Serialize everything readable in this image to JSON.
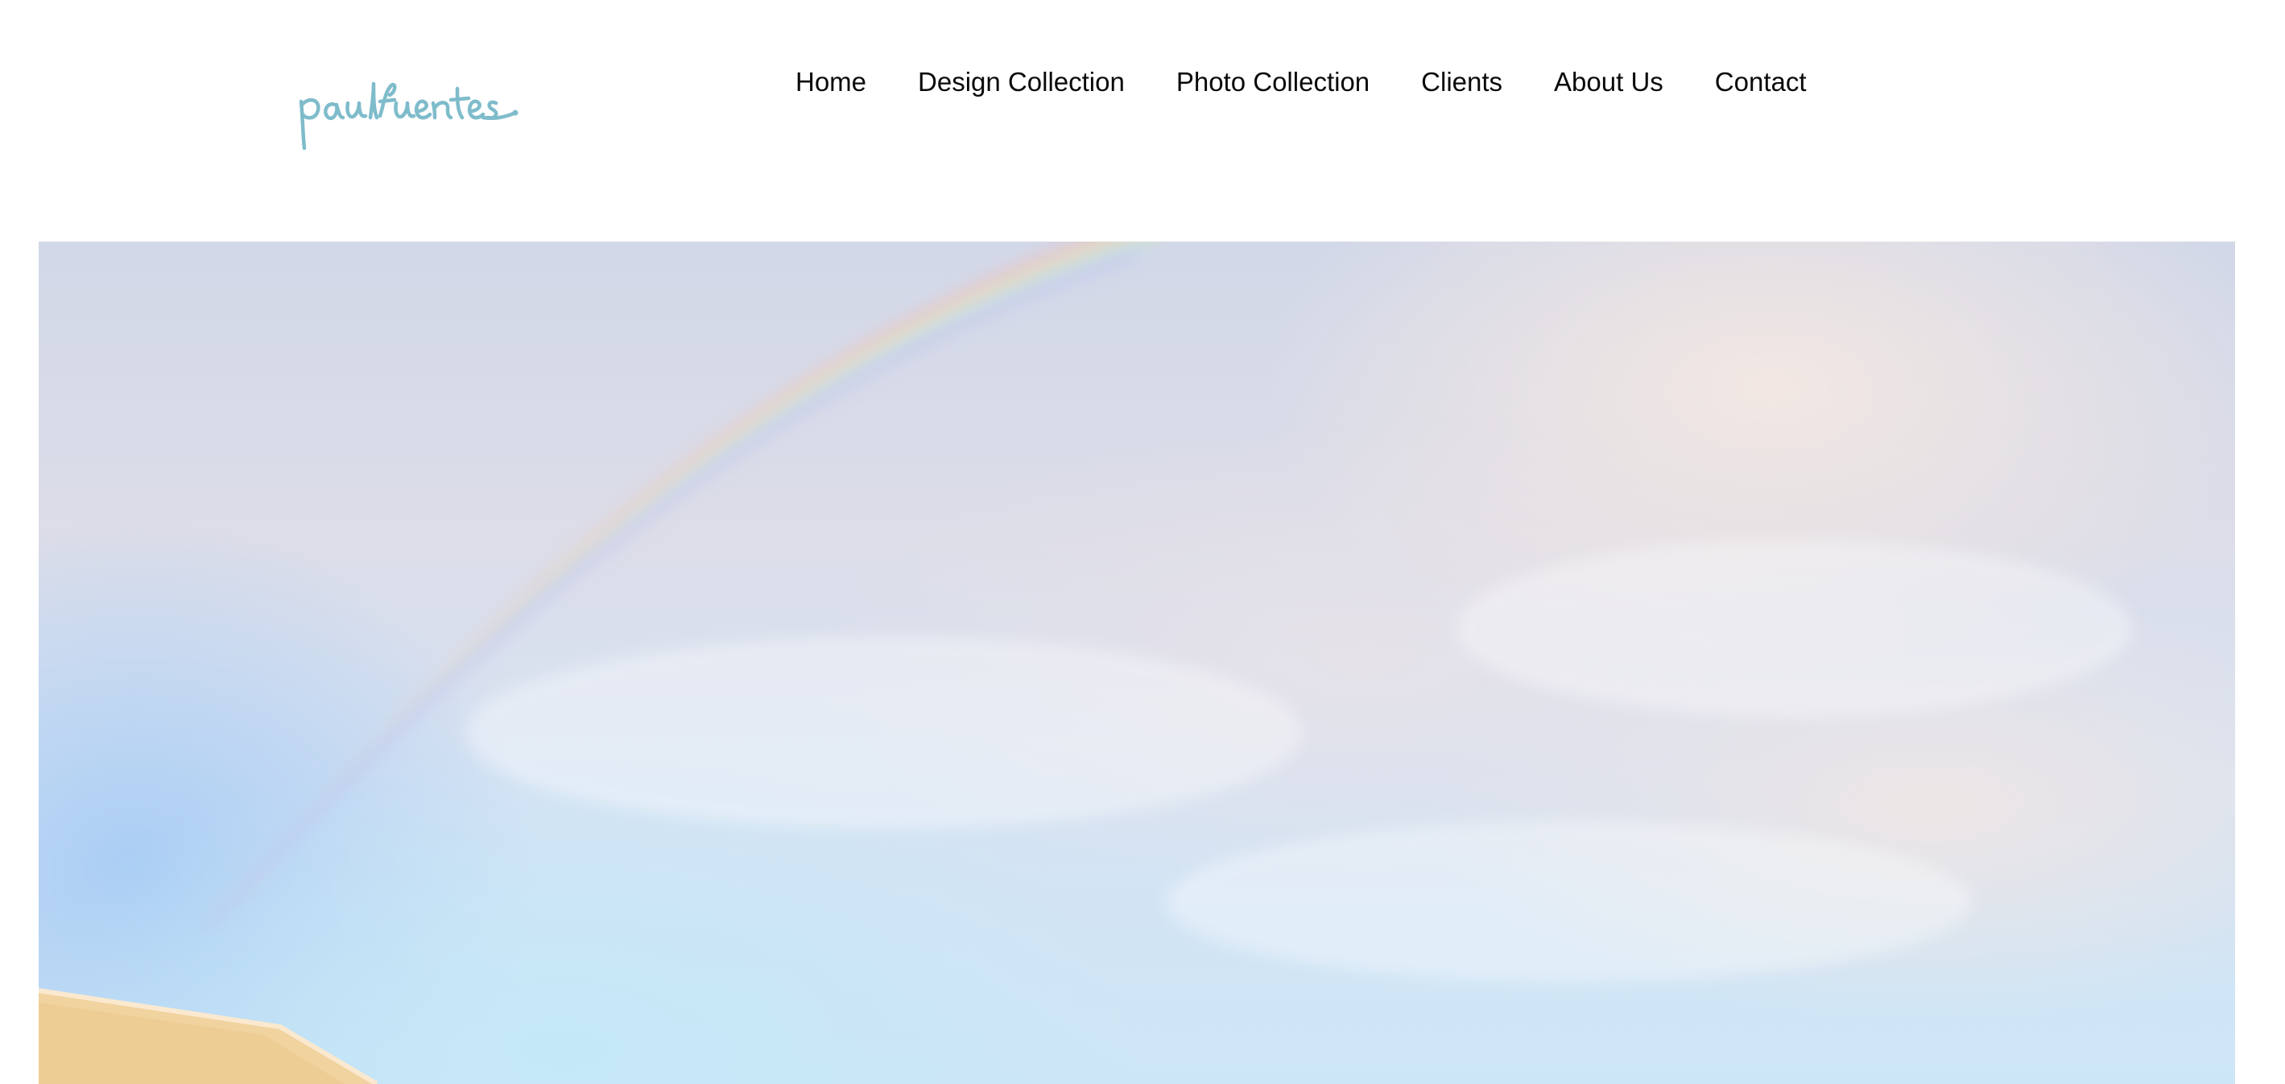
{
  "brand": {
    "logo_text": "paulfuentes.",
    "logo_color": "#7fbccb"
  },
  "nav": {
    "items": [
      {
        "label": "Home"
      },
      {
        "label": "Design Collection"
      },
      {
        "label": "Photo Collection"
      },
      {
        "label": "Clients"
      },
      {
        "label": "About Us"
      },
      {
        "label": "Contact"
      }
    ]
  },
  "hero": {
    "image": "sky-with-rainbow-photo"
  }
}
